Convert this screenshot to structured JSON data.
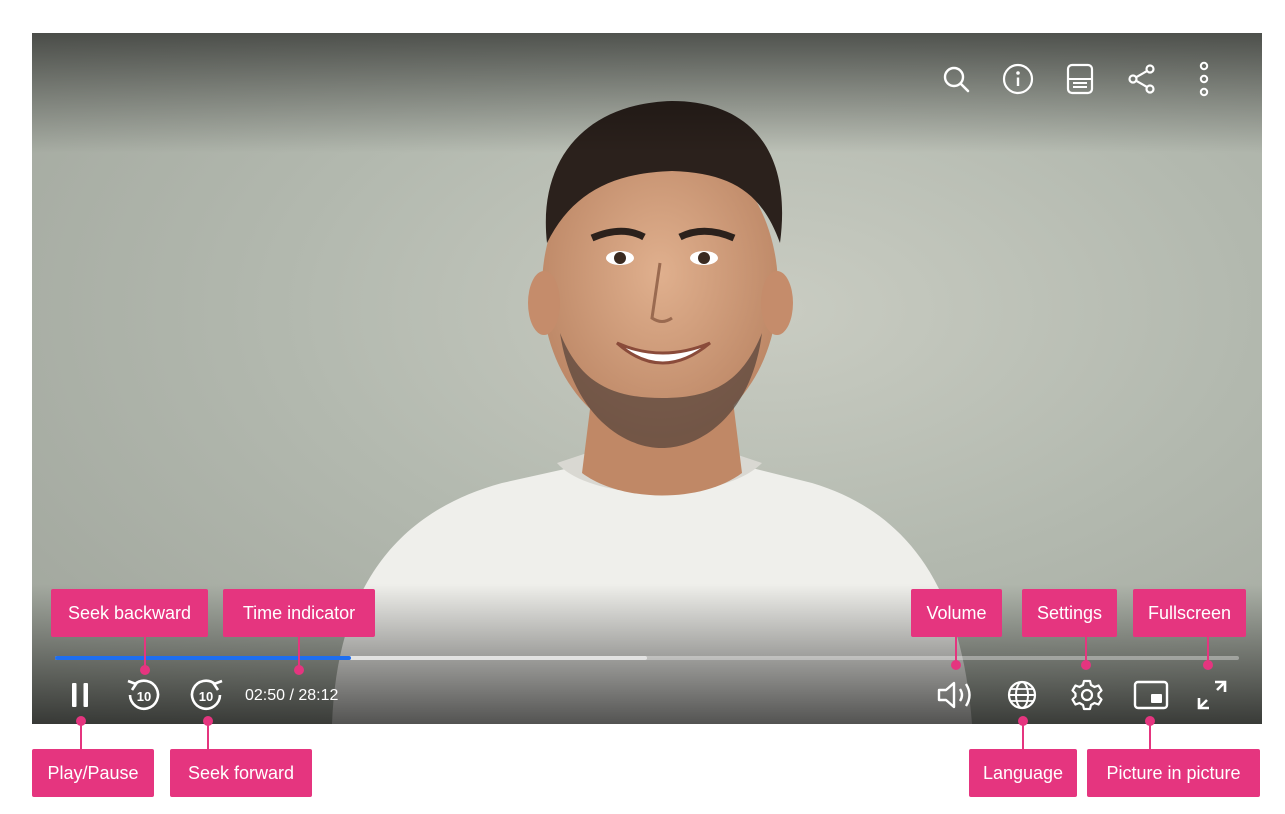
{
  "player": {
    "time": {
      "current": "02:50",
      "total": "28:12",
      "display": "02:50 / 28:12"
    },
    "progress": {
      "played_fraction": 0.25,
      "buffered_fraction": 0.5
    },
    "top_icons": [
      "search-icon",
      "info-icon",
      "captions-icon",
      "share-icon",
      "more-vertical-icon"
    ],
    "accent_color": "#1e6ef0"
  },
  "annotations": {
    "seek_backward": "Seek backward",
    "time_indicator": "Time indicator",
    "volume": "Volume",
    "settings": "Settings",
    "fullscreen": "Fullscreen",
    "play_pause": "Play/Pause",
    "seek_forward": "Seek forward",
    "language": "Language",
    "picture_in_picture": "Picture in picture",
    "color": "#e5357f"
  },
  "seek_icon_text": "10"
}
